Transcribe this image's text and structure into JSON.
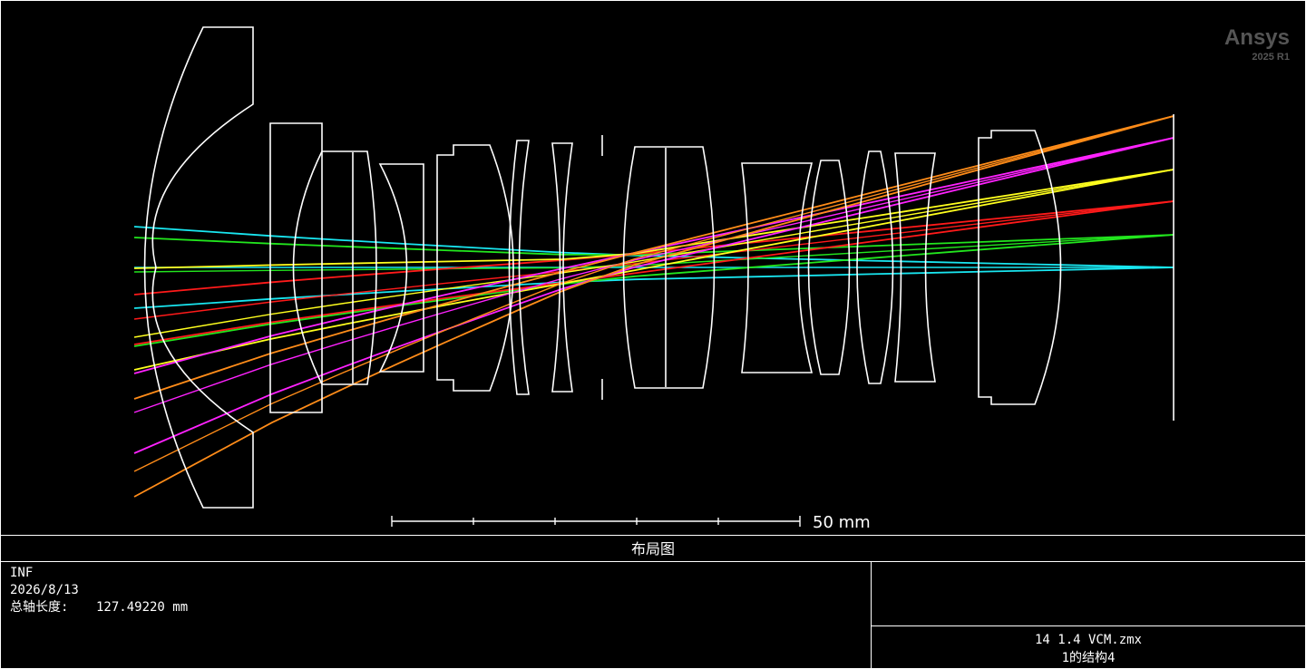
{
  "watermark": {
    "brand": "Ansys",
    "version": "2025 R1"
  },
  "scale_bar": {
    "label": "50 mm"
  },
  "plot_title": "布局图",
  "info": {
    "line1": "INF",
    "date": "2026/8/13",
    "total_length_label": "总轴长度:",
    "total_length_value": "127.49220 mm"
  },
  "file": {
    "name": "14 1.4 VCM.zmx",
    "config": "1的结构4"
  },
  "colors": {
    "background": "#000000",
    "line": "#ffffff",
    "ray_fields": [
      "#19e6f0",
      "#22e61e",
      "#ff1a1a",
      "#ffff1e",
      "#ff22ff",
      "#ff8c19"
    ]
  },
  "field_count": 6
}
